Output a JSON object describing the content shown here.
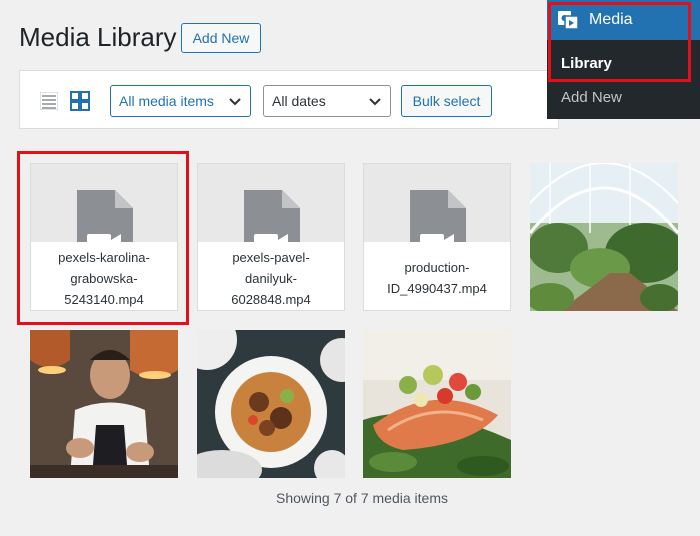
{
  "header": {
    "title": "Media Library",
    "add_new": "Add New"
  },
  "toolbar": {
    "filter_type": "All media items",
    "filter_date": "All dates",
    "bulk_select": "Bulk select"
  },
  "admin_menu": {
    "media": "Media",
    "library": "Library",
    "add_new": "Add New"
  },
  "media_items": [
    {
      "kind": "video",
      "caption": [
        "pexels-karolina-",
        "grabowska-",
        "5243140.mp4"
      ]
    },
    {
      "kind": "video",
      "caption": [
        "pexels-pavel-",
        "danilyuk-",
        "6028848.mp4"
      ]
    },
    {
      "kind": "video",
      "caption": [
        "production-",
        "ID_4990437.mp4"
      ]
    },
    {
      "kind": "image",
      "subject": "greenhouse garden"
    },
    {
      "kind": "image",
      "subject": "chef cooking"
    },
    {
      "kind": "image",
      "subject": "plated meal top view"
    },
    {
      "kind": "image",
      "subject": "salmon with salad"
    }
  ],
  "footer": {
    "count_text": "Showing 7 of 7 media items"
  },
  "colors": {
    "accent": "#2271b1",
    "highlight": "#e3101a",
    "menu_bg": "#23282d"
  }
}
